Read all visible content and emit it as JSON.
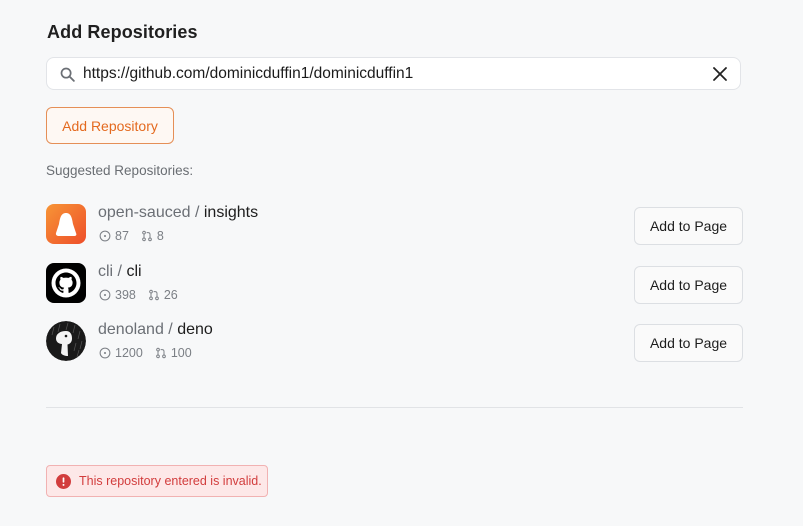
{
  "header": {
    "title": "Add Repositories"
  },
  "search": {
    "value": "https://github.com/dominicduffin1/dominicduffin1"
  },
  "add_repository_label": "Add Repository",
  "suggested": {
    "label": "Suggested Repositories:",
    "add_to_page_label": "Add to Page",
    "items": [
      {
        "org": "open-sauced",
        "name": "insights",
        "issues": "87",
        "prs": "8",
        "avatar": "open-sauced-logo"
      },
      {
        "org": "cli",
        "name": "cli",
        "issues": "398",
        "prs": "26",
        "avatar": "github-logo"
      },
      {
        "org": "denoland",
        "name": "deno",
        "issues": "1200",
        "prs": "100",
        "avatar": "deno-logo"
      }
    ]
  },
  "error": {
    "message": "This repository entered is invalid.",
    "icon": "alert-circle-icon",
    "color": "#d23d3d"
  },
  "colors": {
    "accent": "#e46a1f",
    "background": "#f7f8f9"
  }
}
